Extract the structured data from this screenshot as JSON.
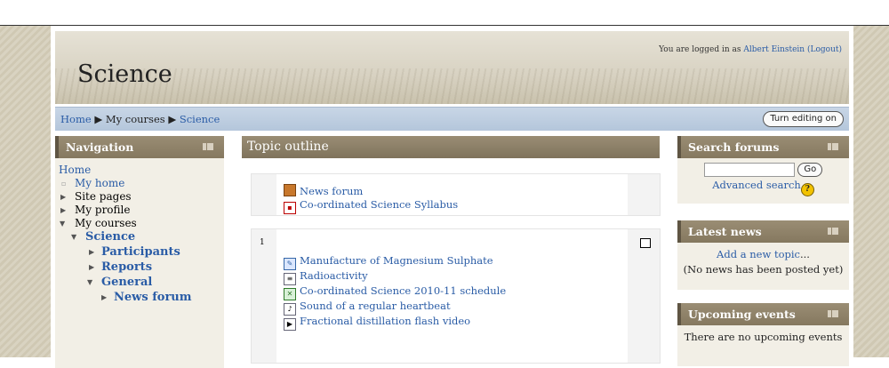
{
  "header": {
    "site_title": "Science",
    "login_prefix": "You are logged in as ",
    "user_name": "Albert Einstein",
    "logout_label": "(Logout)"
  },
  "navbar": {
    "breadcrumb": [
      "Home",
      "My courses",
      "Science"
    ],
    "separator": "▶",
    "edit_button": "Turn editing on"
  },
  "navigation": {
    "title": "Navigation",
    "items": [
      {
        "label": "Home",
        "link": true
      },
      {
        "label": "My home",
        "link": true
      },
      {
        "label": "Site pages",
        "link": false
      },
      {
        "label": "My profile",
        "link": false
      },
      {
        "label": "My courses",
        "link": false
      },
      {
        "label": "Science",
        "link": true
      },
      {
        "label": "Participants",
        "link": true
      },
      {
        "label": "Reports",
        "link": true
      },
      {
        "label": "General",
        "link": true
      },
      {
        "label": "News forum",
        "link": true
      }
    ]
  },
  "main": {
    "title": "Topic outline",
    "section0": {
      "activities": [
        "News forum",
        "Co-ordinated Science Syllabus"
      ]
    },
    "section1": {
      "number": "1",
      "activities": [
        "Manufacture of Magnesium Sulphate",
        "Radioactivity",
        "Co-ordinated Science 2010-11 schedule",
        "Sound of a regular heartbeat",
        "Fractional distillation flash video"
      ]
    }
  },
  "search_forums": {
    "title": "Search forums",
    "go_label": "Go",
    "advanced_label": "Advanced search",
    "help_label": "?"
  },
  "latest_news": {
    "title": "Latest news",
    "add_label": "Add a new topic",
    "empty_label": "(No news has been posted yet)"
  },
  "upcoming_events": {
    "title": "Upcoming events",
    "empty_label": "There are no upcoming events"
  }
}
